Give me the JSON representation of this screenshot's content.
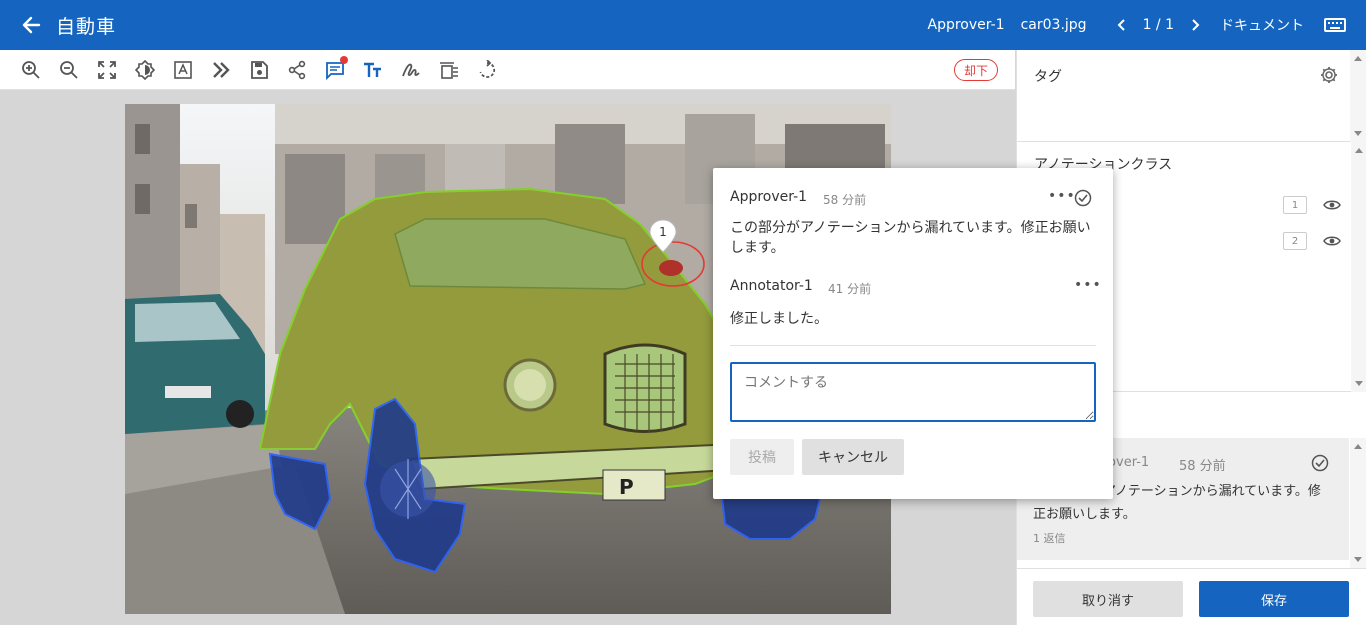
{
  "header": {
    "title": "自動車",
    "role": "Approver-1",
    "filename": "car03.jpg",
    "page_indicator": "1 / 1",
    "document_label": "ドキュメント"
  },
  "toolbar": {
    "tools": [
      "zoom-in-icon",
      "zoom-out-icon",
      "fit-screen-icon",
      "brightness-icon",
      "text-select-icon",
      "chevrons-right-icon",
      "save-icon",
      "share-icon",
      "comment-icon",
      "text-size-icon",
      "signature-icon",
      "tag-list-icon",
      "rotate-icon"
    ],
    "reject_label": "却下"
  },
  "canvas": {
    "marker_number": "1"
  },
  "sidebar": {
    "tag_label": "タグ",
    "annotation_class_label": "アノテーションクラス",
    "classes": [
      {
        "badge": "1"
      },
      {
        "badge": "2"
      }
    ],
    "comment_card": {
      "author": "rover-1",
      "time": "58 分前",
      "text": "アノテーションから漏れています。修正お願いします。",
      "replies": "1 返信"
    },
    "cancel_label": "取り消す",
    "save_label": "保存"
  },
  "popup": {
    "comments": [
      {
        "author": "Approver-1",
        "time": "58 分前",
        "text": "この部分がアノテーションから漏れています。修正お願いします。"
      },
      {
        "author": "Annotator-1",
        "time": "41 分前",
        "text": "修正しました。"
      }
    ],
    "input_placeholder": "コメントする",
    "post_label": "投稿",
    "cancel_label": "キャンセル"
  },
  "colors": {
    "primary": "#1565c0",
    "reject": "#e53935",
    "annotation_car": "#8bc34a",
    "annotation_wheel": "#1a3fb8"
  }
}
